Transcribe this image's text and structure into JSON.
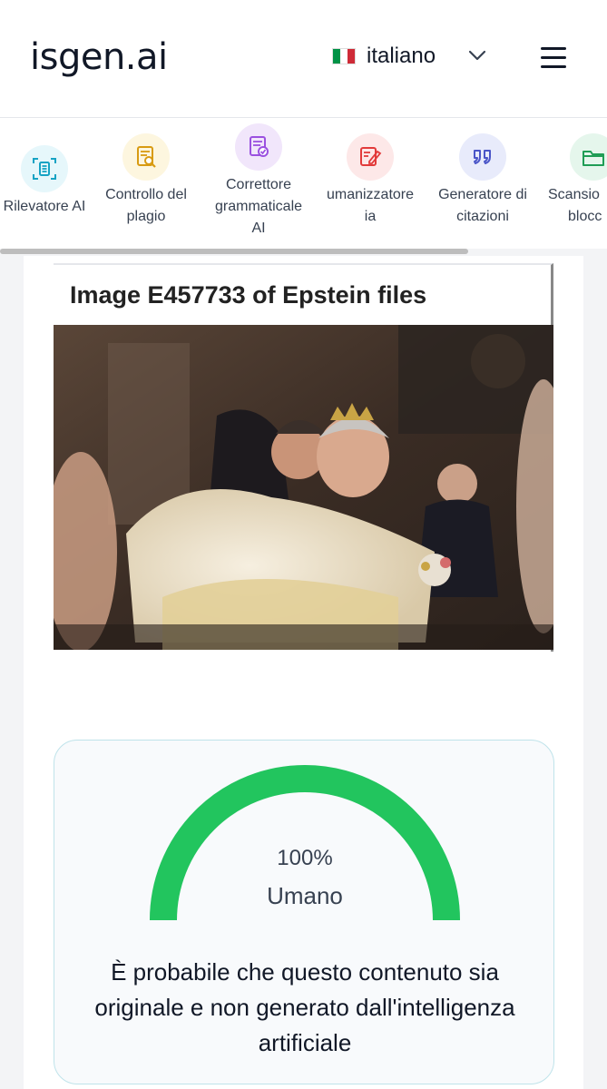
{
  "header": {
    "logo": "isgen.ai",
    "language": "italiano",
    "flag_colors": [
      "#009246",
      "#ffffff",
      "#ce2b37"
    ]
  },
  "tools": [
    {
      "label_lines": [
        "Rilevatore AI"
      ],
      "icon": "ai-scan-icon",
      "bg": "#e6f7fb",
      "color": "#16a3c4"
    },
    {
      "label_lines": [
        "Controllo del",
        "plagio"
      ],
      "icon": "plagiarism-check-icon",
      "bg": "#fdf6df",
      "color": "#d89b12"
    },
    {
      "label_lines": [
        "Correttore",
        "grammaticale",
        "AI"
      ],
      "icon": "grammar-check-icon",
      "bg": "#f1e6fb",
      "color": "#9b51e0"
    },
    {
      "label_lines": [
        "umanizzatore",
        "ia"
      ],
      "icon": "humanizer-icon",
      "bg": "#fde8e8",
      "color": "#e23b3b"
    },
    {
      "label_lines": [
        "Generatore di",
        "citazioni"
      ],
      "icon": "quote-icon",
      "bg": "#e8ebfb",
      "color": "#4a55c8"
    },
    {
      "label_lines": [
        "Scansio",
        "blocc"
      ],
      "icon": "folder-icon",
      "bg": "#e5f6ec",
      "color": "#1f9d55"
    }
  ],
  "image": {
    "title": "Image E457733 of Epstein files"
  },
  "result": {
    "percent": "100%",
    "percent_value": 100,
    "label": "Umano",
    "message": "È probabile che questo contenuto sia originale e non generato dall'intelligenza artificiale",
    "gauge_color": "#22c55e"
  }
}
